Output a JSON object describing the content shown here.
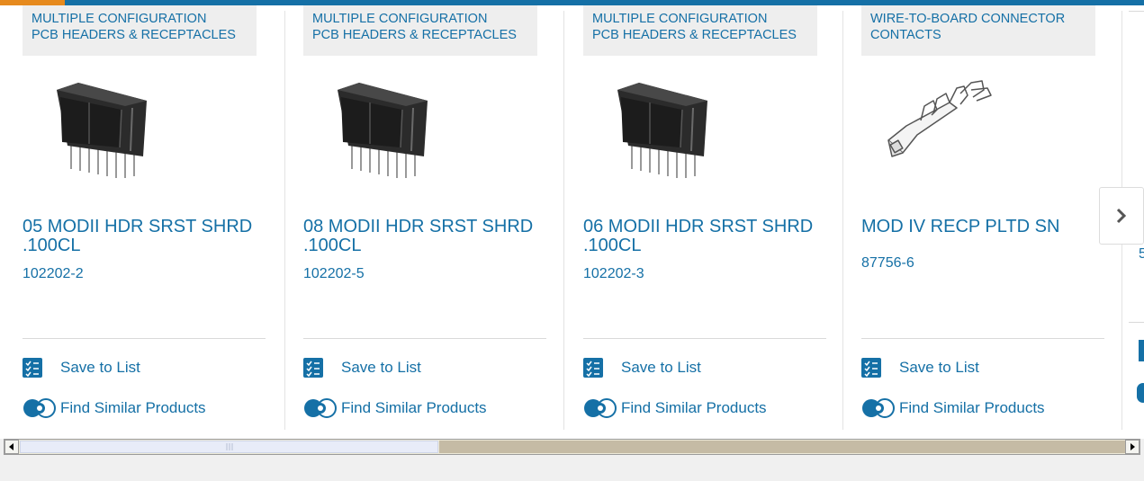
{
  "colors": {
    "accent": "#1570a6",
    "orange": "#e68a1e"
  },
  "cards": [
    {
      "category_lines": [
        "MULTIPLE CONFIGURATION",
        "PCB HEADERS & RECEPTACLES"
      ],
      "title_lines": [
        "05 MODII HDR SRST SHRD",
        ".100CL"
      ],
      "part_number": "102202-2",
      "image": "pcb-header-image",
      "save_label": "Save to List",
      "similar_label": "Find Similar Products"
    },
    {
      "category_lines": [
        "MULTIPLE CONFIGURATION",
        "PCB HEADERS & RECEPTACLES"
      ],
      "title_lines": [
        "08 MODII HDR SRST SHRD",
        ".100CL"
      ],
      "part_number": "102202-5",
      "image": "pcb-header-image",
      "save_label": "Save to List",
      "similar_label": "Find Similar Products"
    },
    {
      "category_lines": [
        "MULTIPLE CONFIGURATION",
        "PCB HEADERS & RECEPTACLES"
      ],
      "title_lines": [
        "06 MODII HDR SRST SHRD",
        ".100CL"
      ],
      "part_number": "102202-3",
      "image": "pcb-header-image",
      "save_label": "Save to List",
      "similar_label": "Find Similar Products"
    },
    {
      "category_lines": [
        "WIRE-TO-BOARD CONNECTOR",
        "CONTACTS"
      ],
      "title_lines": [
        "MOD IV RECP PLTD SN"
      ],
      "part_number": "87756-6",
      "image": "crimp-contact-image",
      "save_label": "Save to List",
      "similar_label": "Find Similar Products"
    }
  ],
  "peek": {
    "text": "5"
  },
  "carousel": {
    "next_icon": "chevron-right-icon"
  },
  "scrollbar": {
    "left_icon": "arrow-left-icon",
    "right_icon": "arrow-right-icon"
  }
}
